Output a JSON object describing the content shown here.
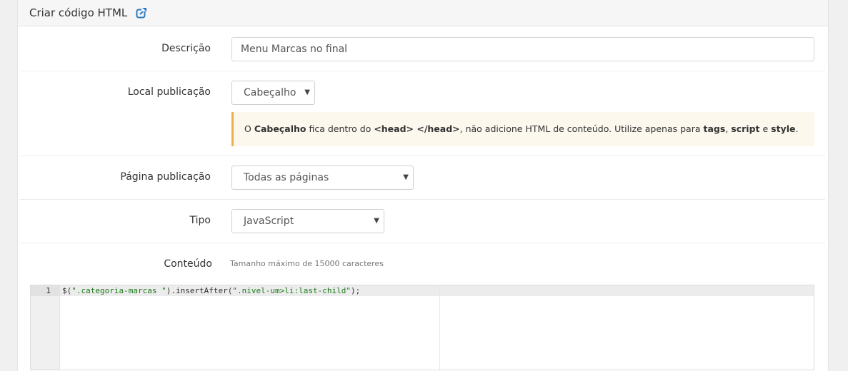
{
  "header": {
    "title": "Criar código HTML",
    "icon": "external-link-icon"
  },
  "form": {
    "descricao": {
      "label": "Descrição",
      "value": "Menu Marcas no final"
    },
    "local": {
      "label": "Local publicação",
      "selected": "Cabeçalho",
      "alert": {
        "p1": "O ",
        "b1": "Cabeçalho",
        "p2": " fica dentro do ",
        "b2": "<head> </head>",
        "p3": ", não adicione HTML de conteúdo. Utilize apenas para ",
        "b3": "tags",
        "p4": ", ",
        "b4": "script",
        "p5": " e ",
        "b5": "style",
        "p6": "."
      }
    },
    "pagina": {
      "label": "Página publicação",
      "selected": "Todas as páginas"
    },
    "tipo": {
      "label": "Tipo",
      "selected": "JavaScript"
    },
    "conteudo": {
      "label": "Conteúdo",
      "help": "Tamanho máximo de 15000 caracteres",
      "line_number": "1",
      "code_a": "$(",
      "code_s1": "\".categoria-marcas \"",
      "code_b": ").insertAfter(",
      "code_s2": "\".nivel-um>li:last-child\"",
      "code_c": ");"
    }
  },
  "colors": {
    "accent": "#2a7bc0",
    "alert_border": "#f0ad4e",
    "alert_bg": "#fcf8ee"
  }
}
